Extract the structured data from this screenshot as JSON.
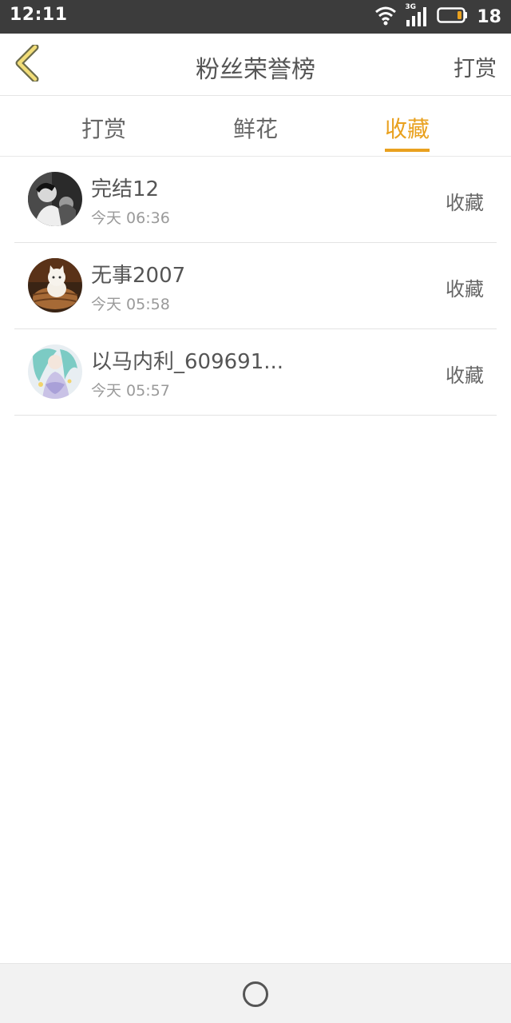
{
  "status_bar": {
    "time": "12:11",
    "network": "3G",
    "battery": "18",
    "icons": [
      "wifi-icon",
      "signal-icon",
      "battery-icon"
    ]
  },
  "header": {
    "title": "粉丝荣誉榜",
    "action": "打赏",
    "back_icon": "chevron-left-icon"
  },
  "tabs": [
    {
      "label": "打赏",
      "active": false
    },
    {
      "label": "鲜花",
      "active": false
    },
    {
      "label": "收藏",
      "active": true
    }
  ],
  "list": [
    {
      "name": "完结12",
      "time": "今天 06:36",
      "action": "收藏",
      "avatar": "avatar-photo-bw"
    },
    {
      "name": "无事2007",
      "time": "今天 05:58",
      "action": "收藏",
      "avatar": "avatar-kitten"
    },
    {
      "name": "以马内利_609691...",
      "time": "今天 05:57",
      "action": "收藏",
      "avatar": "avatar-anime"
    }
  ],
  "colors": {
    "accent": "#e9a11f",
    "status_bar": "#3c3c3c",
    "text": "#555555",
    "subtext": "#9a9a9a"
  },
  "nav_bar": {
    "home_icon": "home-circle-icon"
  }
}
